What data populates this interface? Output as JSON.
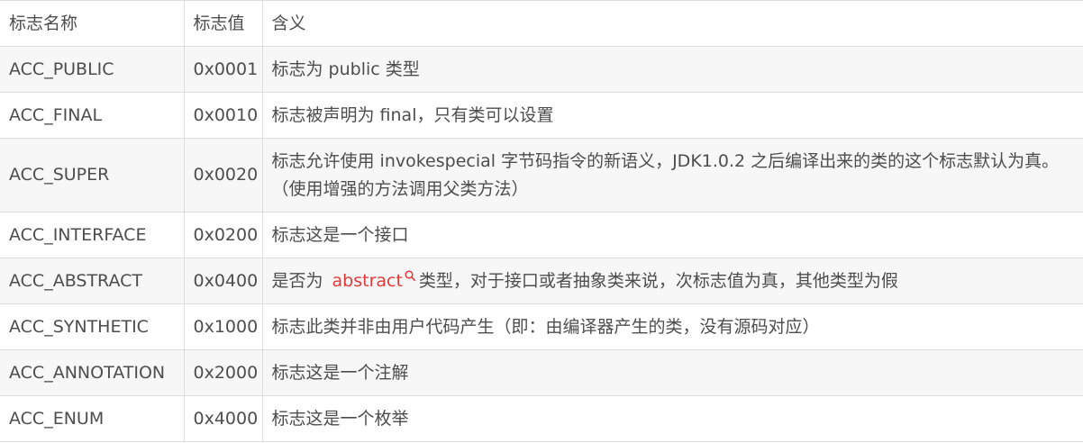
{
  "table": {
    "headers": [
      "标志名称",
      "标志值",
      "含义"
    ],
    "rows": [
      {
        "name": "ACC_PUBLIC",
        "value": "0x0001",
        "meaning": "标志为 public 类型"
      },
      {
        "name": "ACC_FINAL",
        "value": "0x0010",
        "meaning": "标志被声明为 final，只有类可以设置"
      },
      {
        "name": "ACC_SUPER",
        "value": "0x0020",
        "meaning": "标志允许使用 invokespecial 字节码指令的新语义，JDK1.0.2 之后编译出来的类的这个标志默认为真。（使用增强的方法调用父类方法）"
      },
      {
        "name": "ACC_INTERFACE",
        "value": "0x0200",
        "meaning": "标志这是一个接口"
      },
      {
        "name": "ACC_ABSTRACT",
        "value": "0x0400",
        "meaning_prefix": "是否为",
        "meaning_link": "abstract",
        "meaning_suffix": "类型，对于接口或者抽象类来说，次标志值为真，其他类型为假",
        "link_icon": "search-icon"
      },
      {
        "name": "ACC_SYNTHETIC",
        "value": "0x1000",
        "meaning": "标志此类并非由用户代码产生（即：由编译器产生的类，没有源码对应）"
      },
      {
        "name": "ACC_ANNOTATION",
        "value": "0x2000",
        "meaning": "标志这是一个注解"
      },
      {
        "name": "ACC_ENUM",
        "value": "0x4000",
        "meaning": "标志这是一个枚举"
      }
    ]
  },
  "colors": {
    "text": "#4d4d4d",
    "border": "#dddddd",
    "stripe": "#f7f7f7",
    "link": "#e4393c"
  }
}
